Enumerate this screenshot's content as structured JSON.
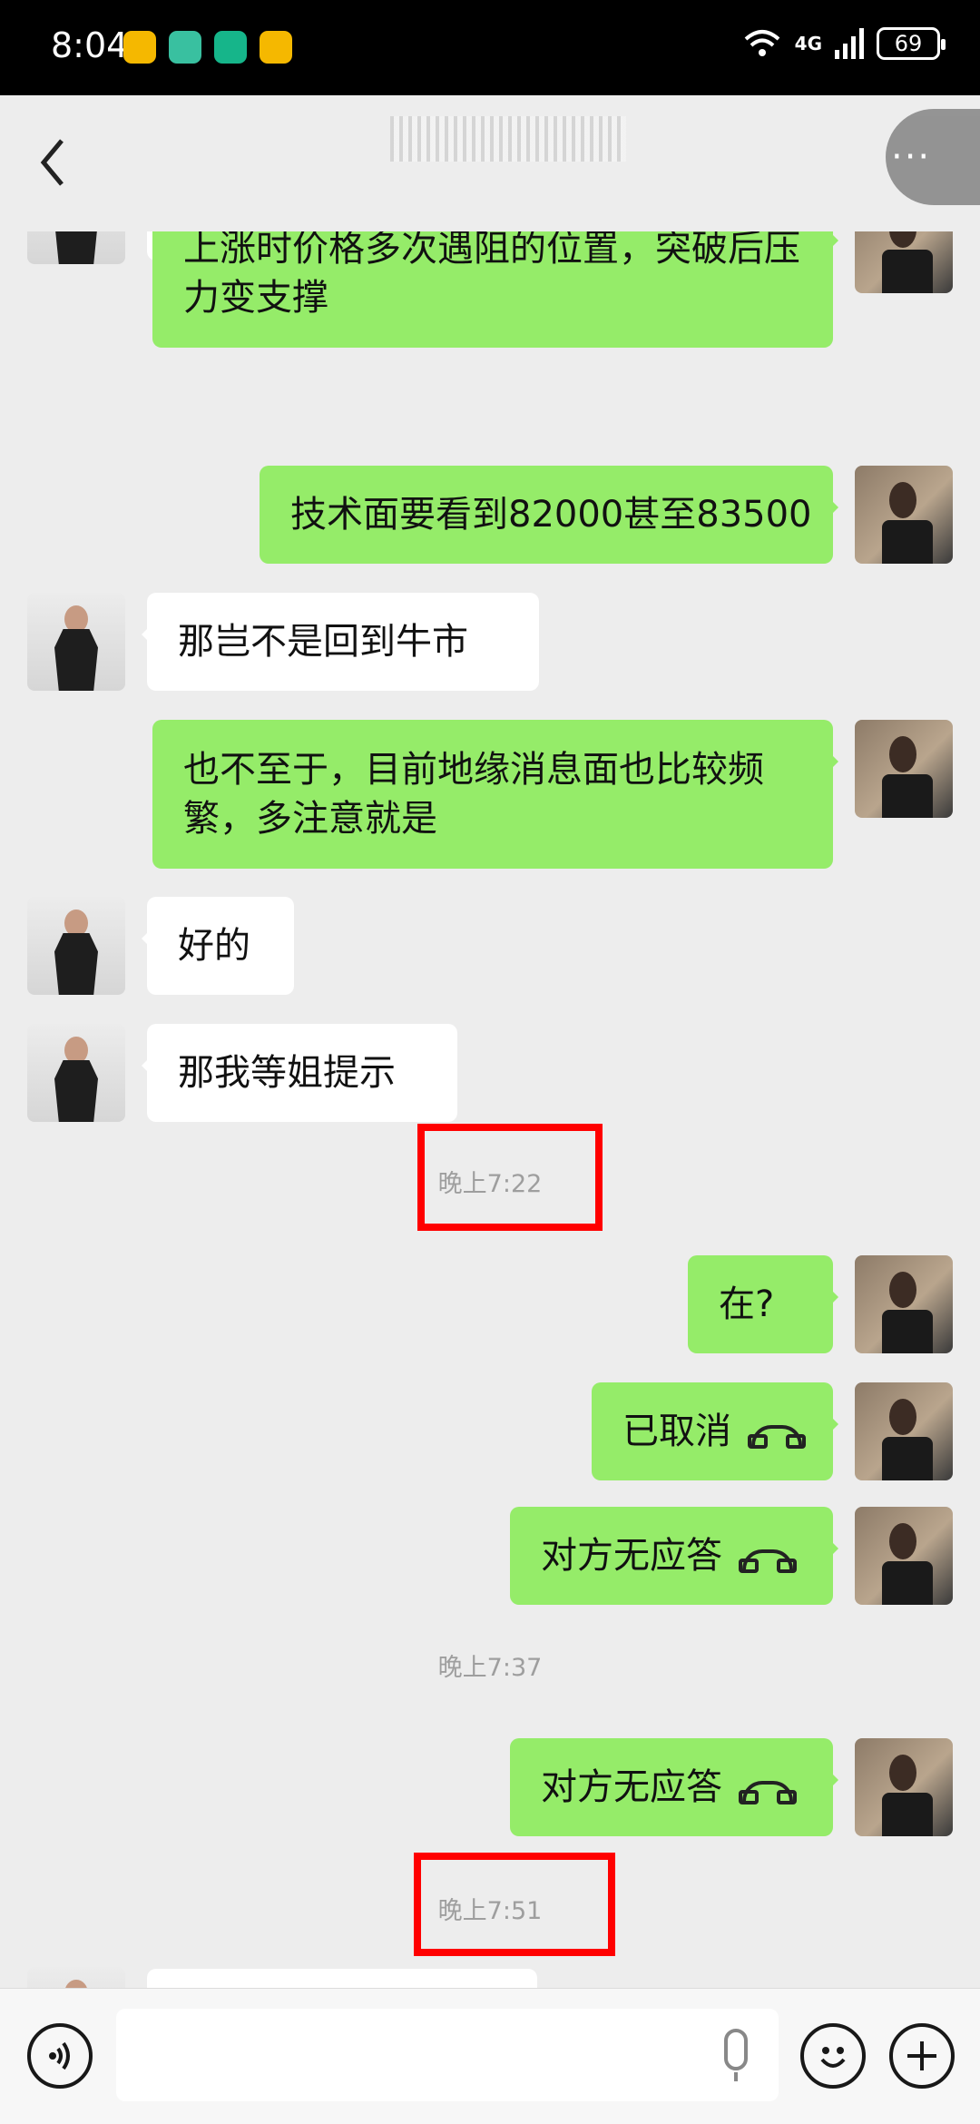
{
  "status_bar": {
    "time": "8:04",
    "network": "4G",
    "battery": "69"
  },
  "nav": {
    "back_label": "‹",
    "more_label": "···"
  },
  "messages": [
    {
      "from": "me",
      "text": "上涨时价格多次遇阻的位置，突破后压力变支撑"
    },
    {
      "from": "me",
      "text": "技术面要看到82000甚至83500"
    },
    {
      "from": "other",
      "text": "那岂不是回到牛市"
    },
    {
      "from": "me",
      "text": "也不至于，目前地缘消息面也比较频繁，多注意就是"
    },
    {
      "from": "other",
      "text": "好的"
    },
    {
      "from": "other",
      "text": "那我等姐提示"
    },
    {
      "from": "me",
      "text": "在?"
    },
    {
      "from": "me",
      "text": "已取消",
      "call": true
    },
    {
      "from": "me",
      "text": "对方无应答",
      "call": true
    },
    {
      "from": "me",
      "text": "对方无应答",
      "call": true
    }
  ],
  "timestamps": [
    "晚上7:22",
    "晚上7:37",
    "晚上7:51"
  ],
  "colors": {
    "my_bubble": "#95ec69",
    "other_bubble": "#ffffff",
    "background": "#ededed",
    "highlight_box": "#ff0000"
  },
  "icons": [
    "back-chevron-icon",
    "more-icon",
    "voice-icon",
    "mic-icon",
    "emoji-icon",
    "plus-icon",
    "hangup-icon"
  ]
}
